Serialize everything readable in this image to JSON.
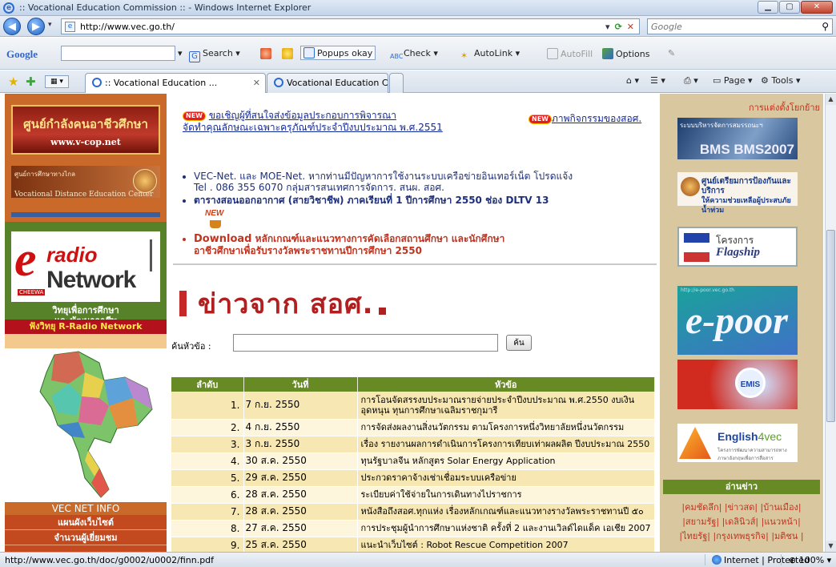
{
  "window": {
    "title": ":: Vocational Education Commission :: - Windows Internet Explorer",
    "min_label": "▁",
    "max_label": "▢",
    "close_label": "✕"
  },
  "address": {
    "url": "http://www.vec.go.th/",
    "search_placeholder": "Google"
  },
  "google_toolbar": {
    "logo": "Google",
    "search_label": "Search",
    "popups_label": "Popups okay",
    "check_label": "Check",
    "autolink_label": "AutoLink",
    "autofill_label": "AutoFill",
    "options_label": "Options"
  },
  "tabs": [
    {
      "label": ":: Vocational Education ..."
    },
    {
      "label": "Vocational Education Com..."
    }
  ],
  "commands": {
    "page": "Page",
    "tools": "Tools"
  },
  "left": {
    "vcop_title": "ศูนย์กำลังคนอาชีวศึกษา",
    "vcop_url": "www.v-cop.net",
    "vdec_title": "ศูนย์การศึกษาทางไกล",
    "vdec_sub": "Vocational Distance Education Center",
    "radio_word": "radio",
    "network_word": "Network",
    "cheewa": "CHEEWA",
    "radio_caption_1": "วิทยุเพื่อการศึกษา",
    "radio_caption_2": "และพัฒนาอาชีพ",
    "radio_listen": "ฟังวิทยุ R-Radio Network",
    "vec_info": "VEC NET INFO",
    "links": [
      "แผนผังเว็บไซต์",
      "จำนวนผู้เยี่ยมชม"
    ]
  },
  "center": {
    "top_link_1": "ขอเชิญผู้ที่สนใจส่งข้อมูลประกอบการพิจารณา",
    "top_link_2": "จัดทำคุณลักษณะเฉพาะครุภัณฑ์ประจำปีงบประมาณ พ.ศ.2551",
    "activities_link": "ภาพกิจกรรมของสอศ.",
    "new_badge": "NEW",
    "bullet_1a": "VEC-Net. และ MOE-Net. หากท่านมีปัญหาการใช้งานระบบเครือข่ายอินเทอร์เน็ต โปรดแจ้ง",
    "bullet_1b": "Tel . 086 355 6070 กลุ่มสารสนเทศการจัดการ. สนผ. สอศ.",
    "bullet_2": "ตารางสอนออกอากาศ (สายวิชาชีพ) ภาคเรียนที่ 1 ปีการศึกษา 2550 ช่อง DLTV 13",
    "bullet_3_word": "Download",
    "bullet_3a": "หลักเกณฑ์และแนวทางการคัดเลือกสถานศึกษา และนักศึกษา",
    "bullet_3b": "อาชีวศึกษาเพื่อรับรางวัลพระราชทานปีการศึกษา 2550",
    "news_title": "ข่าวจาก สอศ.",
    "search_label": "ค้นหัวข้อ :",
    "search_button": "ค้น",
    "table_headers": [
      "ลำดับ",
      "วันที่",
      "หัวข้อ"
    ],
    "rows": [
      {
        "no": "1.",
        "date": "7 ก.ย. 2550",
        "title": "การโอนจัดสรรงบประมาณรายจ่ายประจำปีงบประมาณ พ.ศ.2550 งบเงินอุดหนุน ทุนการศึกษาเฉลิมราชกุมารี"
      },
      {
        "no": "2.",
        "date": "4 ก.ย. 2550",
        "title": "การจัดส่งผลงานสิ่งนวัตกรรม ตามโครงการหนึ่งวิทยาลัยหนึ่งนวัตกรรม"
      },
      {
        "no": "3.",
        "date": "3 ก.ย. 2550",
        "title": "เรื่อง รายงานผลการดำเนินการโครงการเทียบเท่าผลผลิต ปีงบประมาณ 2550"
      },
      {
        "no": "4.",
        "date": "30 ส.ค. 2550",
        "title": "ทุนรัฐบาลจีน หลักสูตร Solar Energy Application"
      },
      {
        "no": "5.",
        "date": "29 ส.ค. 2550",
        "title": "ประกวดราคาจ้างเช่าเชื่อมระบบเครือข่าย"
      },
      {
        "no": "6.",
        "date": "28 ส.ค. 2550",
        "title": "ระเบียบค่าใช้จ่ายในการเดินทางไปราชการ"
      },
      {
        "no": "7.",
        "date": "28 ส.ค. 2550",
        "title": "หนังสือถึงสอศ.ทุกแห่ง เรื่องหลักเกณฑ์และแนวทางรางวัลพระราชทานปี ๕๐"
      },
      {
        "no": "8.",
        "date": "27 ส.ค. 2550",
        "title": "การประชุมผู้นำการศึกษาแห่งชาติ ครั้งที่ 2 และงานเวิลด์ไดแด็ค เอเชีย 2007"
      },
      {
        "no": "9.",
        "date": "25 ส.ค. 2550",
        "title": "แนะนำเว็บไซต์ : Robot Rescue Competition 2007"
      }
    ]
  },
  "right": {
    "header": "การแต่งตั้งโยกย้าย",
    "bms_text": "ระบบบริหารจัดการสมรรถนะฯ",
    "bms_big": "BMS",
    "bms_year": "BMS2007",
    "service_1": "ศูนย์เตรียมการป้องกันและบริการ",
    "service_2": "ให้ความช่วยเหลือผู้ประสบภัยน้ำท่วม",
    "flagship_proj": "โครงการ",
    "flagship_name": "Flagship",
    "epoor_url": "http://e-poor.vec.go.th",
    "epoor": "e-poor",
    "emis": "EMIS",
    "english": "English",
    "english_suffix": "4vec",
    "english_sub": "โครงการพัฒนาความสามารถทางภาษาอังกฤษเพื่อการสื่อสาร",
    "news_read": "อ่านข่าว",
    "papers_1": "|คมชัดลึก| |ข่าวสด| |บ้านเมือง|",
    "papers_2": "|สยามรัฐ| |เดลินิวส์| |แนวหน้า|",
    "papers_3": "|ไทยรัฐ| |กรุงเทพธุรกิจ| |มติชน |"
  },
  "status": {
    "url": "http://www.vec.go.th/doc/g0002/u0002/finn.pdf",
    "zone": "Internet | Protected Mode: On",
    "zoom": "100%"
  }
}
